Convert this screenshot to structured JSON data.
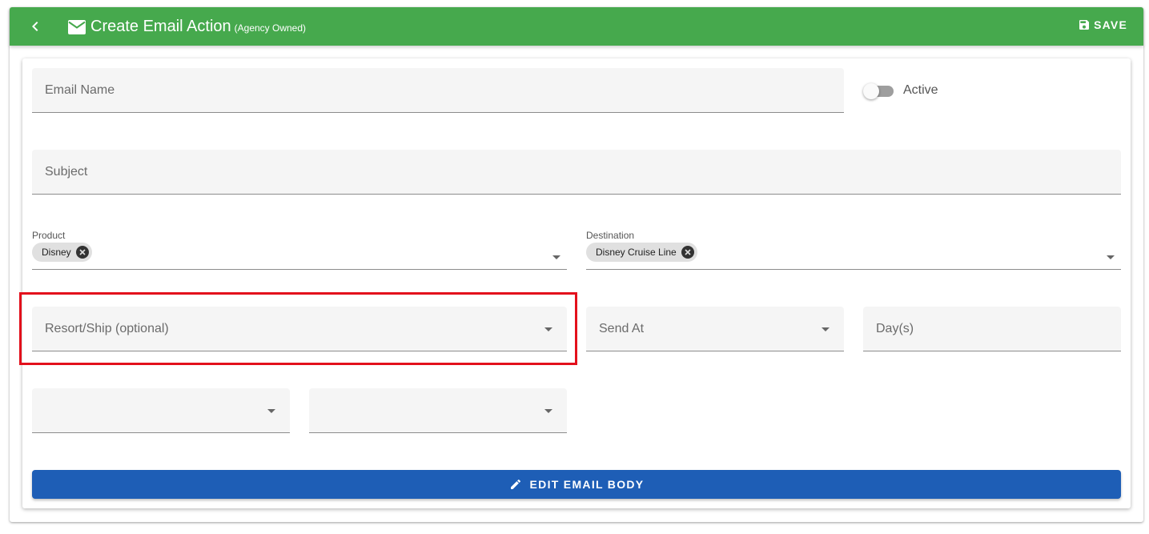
{
  "header": {
    "title": "Create Email Action",
    "subtitle": "(Agency Owned)",
    "save_label": "SAVE",
    "icons": {
      "back": "chevron-left-icon",
      "title": "mail-icon",
      "save": "floppy-disk-icon"
    }
  },
  "form": {
    "email_name": {
      "label": "Email Name",
      "value": ""
    },
    "active": {
      "label": "Active",
      "checked": false
    },
    "subject": {
      "label": "Subject",
      "value": ""
    },
    "product": {
      "label": "Product",
      "chips": [
        "Disney"
      ]
    },
    "destination": {
      "label": "Destination",
      "chips": [
        "Disney Cruise Line"
      ]
    },
    "resort_ship": {
      "label": "Resort/Ship (optional)",
      "value": ""
    },
    "send_at": {
      "label": "Send At",
      "value": ""
    },
    "days": {
      "label": "Day(s)",
      "value": ""
    },
    "select_a": {
      "value": ""
    },
    "select_b": {
      "value": ""
    },
    "edit_body_label": "EDIT EMAIL BODY"
  },
  "colors": {
    "app_bar": "#46a94d",
    "primary_button": "#1e5eb6",
    "highlight": "#e3101c"
  }
}
